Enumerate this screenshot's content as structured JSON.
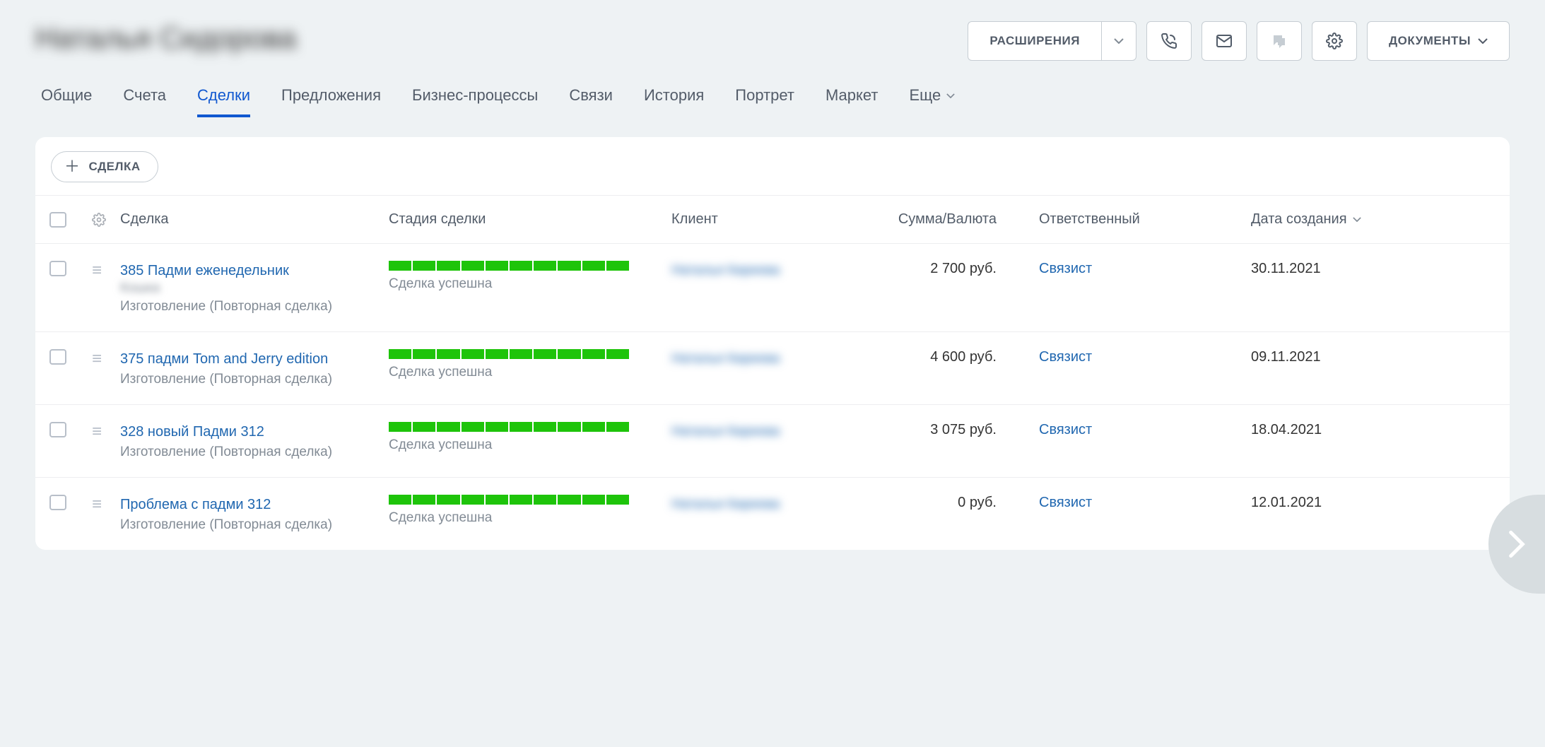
{
  "header": {
    "title_blurred": "Наталья Сидорова",
    "extensions_label": "РАСШИРЕНИЯ",
    "documents_label": "ДОКУМЕНТЫ"
  },
  "tabs": {
    "items": [
      {
        "label": "Общие",
        "active": false
      },
      {
        "label": "Счета",
        "active": false
      },
      {
        "label": "Сделки",
        "active": true
      },
      {
        "label": "Предложения",
        "active": false
      },
      {
        "label": "Бизнес-процессы",
        "active": false
      },
      {
        "label": "Связи",
        "active": false
      },
      {
        "label": "История",
        "active": false
      },
      {
        "label": "Портрет",
        "active": false
      },
      {
        "label": "Маркет",
        "active": false
      }
    ],
    "more_label": "Еще"
  },
  "toolbar": {
    "add_deal_label": "СДЕЛКА"
  },
  "table": {
    "columns": {
      "deal": "Сделка",
      "stage": "Стадия сделки",
      "client": "Клиент",
      "amount": "Сумма/Валюта",
      "responsible": "Ответственный",
      "created": "Дата создания"
    },
    "rows": [
      {
        "title": "385 Падми еженедельник",
        "title_blurred_line": "Кошка",
        "subtitle": "Изготовление (Повторная сделка)",
        "stage_label": "Сделка успешна",
        "client_blurred": "Наталья Киреева",
        "amount": "2 700 руб.",
        "responsible": "Связист",
        "created": "30.11.2021"
      },
      {
        "title": "375 падми Tom and Jerry edition",
        "subtitle": "Изготовление (Повторная сделка)",
        "stage_label": "Сделка успешна",
        "client_blurred": "Наталья Киреева",
        "amount": "4 600 руб.",
        "responsible": "Связист",
        "created": "09.11.2021"
      },
      {
        "title": "328 новый Падми 312",
        "subtitle": "Изготовление (Повторная сделка)",
        "stage_label": "Сделка успешна",
        "client_blurred": "Наталья Киреева",
        "amount": "3 075 руб.",
        "responsible": "Связист",
        "created": "18.04.2021"
      },
      {
        "title": "Проблема с падми 312",
        "subtitle": "Изготовление (Повторная сделка)",
        "stage_label": "Сделка успешна",
        "client_blurred": "Наталья Киреева",
        "amount": "0 руб.",
        "responsible": "Связист",
        "created": "12.01.2021"
      }
    ]
  }
}
